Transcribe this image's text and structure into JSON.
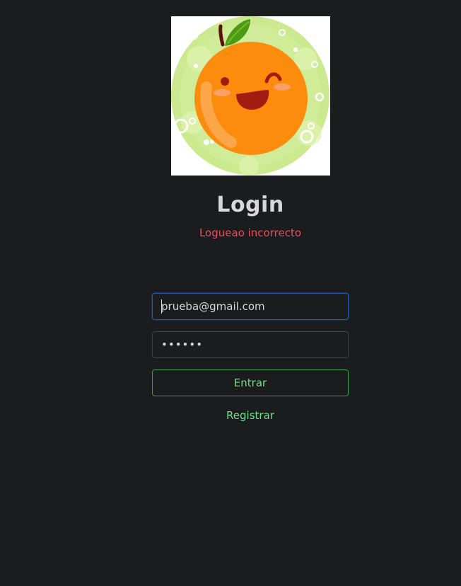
{
  "login": {
    "title": "Login",
    "error_message": "Logueao incorrecto",
    "email_value": "prueba@gmail.com",
    "password_value": "••••••",
    "submit_label": "Entrar",
    "register_label": "Registrar"
  },
  "colors": {
    "background": "#1b1c1e",
    "error": "#ea4d5d",
    "success": "#6ee08a",
    "focus_border": "#1f5cb3",
    "orange": "#fb8c0e",
    "halo": "#c8e88d"
  },
  "icons": {
    "logo": "smiling-orange-logo"
  }
}
